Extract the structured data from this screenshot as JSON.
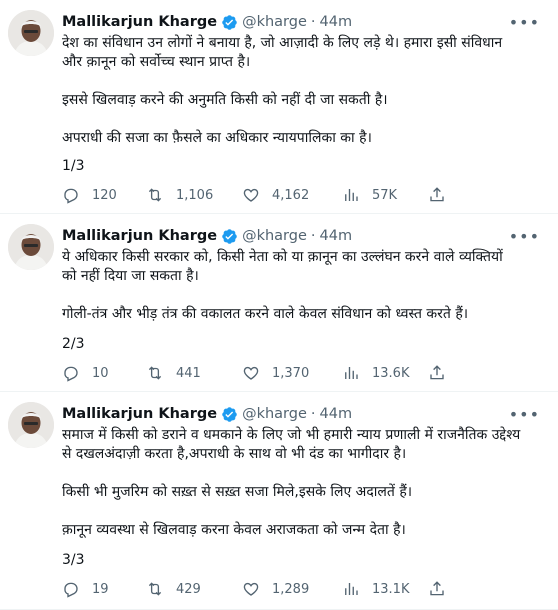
{
  "author": {
    "name": "Mallikarjun Kharge",
    "handle": "@kharge",
    "separator": "·",
    "time": "44m"
  },
  "tweets": [
    {
      "lines": [
        "देश का संविधान उन लोगों ने बनाया है, जो आज़ादी के लिए लड़े थे। हमारा इसी संविधान",
        "और क़ानून को सर्वोच्च स्थान प्राप्त है।",
        "",
        "इससे खिलवाड़ करने की अनुमति किसी को नहीं दी जा सकती है।",
        "",
        "अपराधी की सजा का फ़ैसले का अधिकार न्यायपालिका का है।"
      ],
      "count": "1/3",
      "replies": "120",
      "retweets": "1,106",
      "likes": "4,162",
      "views": "57K"
    },
    {
      "lines": [
        "ये अधिकार किसी सरकार को, किसी नेता को या क़ानून का उल्लंघन करने वाले व्यक्तियों",
        "को नहीं दिया जा सकता है।",
        "",
        "गोली-तंत्र और भीड़ तंत्र की वकालत करने वाले केवल संविधान को ध्वस्त करते हैं।"
      ],
      "count": "2/3",
      "replies": "10",
      "retweets": "441",
      "likes": "1,370",
      "views": "13.6K"
    },
    {
      "lines": [
        "समाज में किसी को डराने व धमकाने के लिए जो भी हमारी न्याय प्रणाली में राजनैतिक उद्देश्य",
        "से दखलअंदाज़ी करता है,अपराधी के साथ वो भी दंड का भागीदार है।",
        "",
        "किसी भी मुजरिम को सख़्त से सख़्त सजा मिले,इसके लिए अदालतें हैं।",
        "",
        "क़ानून व्यवस्था से खिलवाड़ करना केवल अराजकता को जन्म देता है।"
      ],
      "count": "3/3",
      "replies": "19",
      "retweets": "429",
      "likes": "1,289",
      "views": "13.1K"
    }
  ],
  "icons": {
    "reply": "reply-icon",
    "retweet": "retweet-icon",
    "like": "heart-icon",
    "views": "views-icon",
    "share": "share-icon",
    "verified": "verified-badge-icon",
    "more": "more-icon"
  },
  "colors": {
    "text": "#0f1419",
    "muted": "#536471",
    "verified": "#1d9bf0"
  }
}
